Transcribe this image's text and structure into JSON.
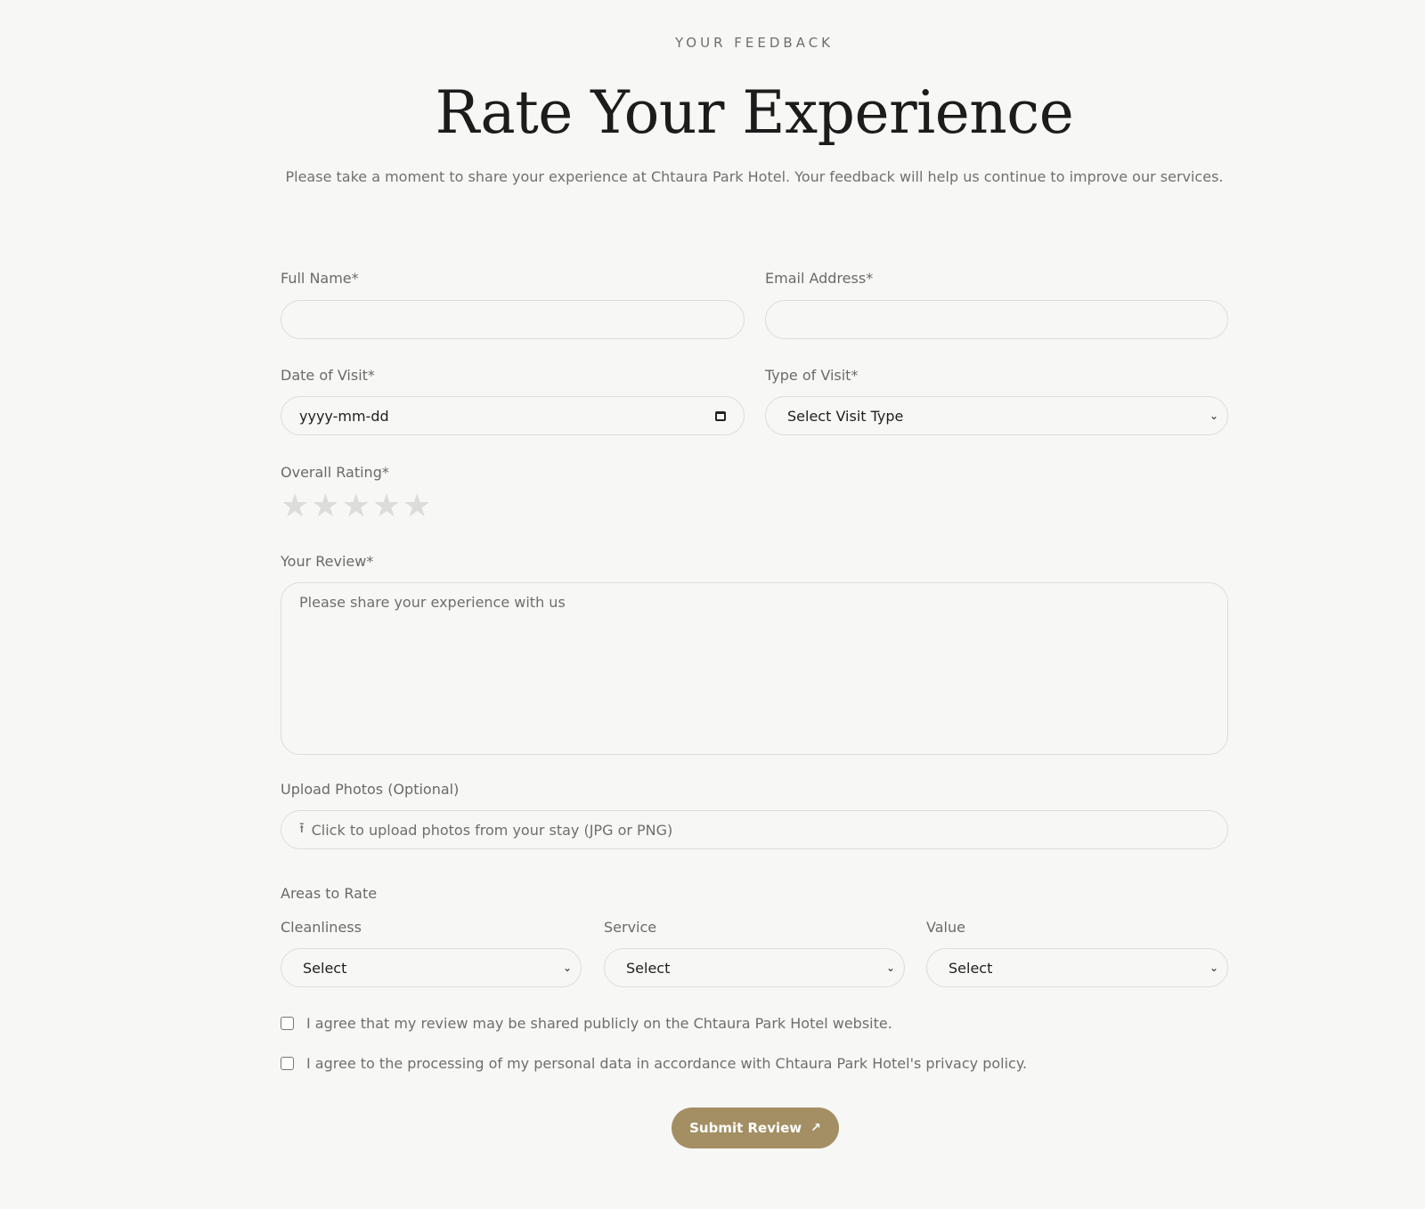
{
  "header": {
    "eyebrow": "YOUR FEEDBACK",
    "title": "Rate Your Experience",
    "subtitle": "Please take a moment to share your experience at Chtaura Park Hotel. Your feedback will help us continue to improve our services."
  },
  "form": {
    "full_name": {
      "label": "Full Name*",
      "value": ""
    },
    "email": {
      "label": "Email Address*",
      "value": ""
    },
    "date": {
      "label": "Date of Visit*",
      "placeholder": "yyyy-mm-dd"
    },
    "visit_type": {
      "label": "Type of Visit*",
      "selected": "Select Visit Type"
    },
    "rating": {
      "label": "Overall Rating*",
      "value": 0,
      "max": 5
    },
    "review": {
      "label": "Your Review*",
      "placeholder": "Please share your experience with us"
    },
    "upload": {
      "label": "Upload Photos (Optional)",
      "text": "Click to upload photos from your stay (JPG or PNG)"
    },
    "areas": {
      "label": "Areas to Rate",
      "cleanliness": {
        "label": "Cleanliness",
        "selected": "Select"
      },
      "service": {
        "label": "Service",
        "selected": "Select"
      },
      "value": {
        "label": "Value",
        "selected": "Select"
      }
    },
    "consent_public": "I agree that my review may be shared publicly on the Chtaura Park Hotel website.",
    "consent_privacy": "I agree to the processing of my personal data in accordance with Chtaura Park Hotel's privacy policy.",
    "submit_label": "Submit Review"
  },
  "icons": {
    "star": "star-icon",
    "calendar": "calendar-icon",
    "chevron": "chevron-down-icon",
    "upload": "upload-icon",
    "arrow": "arrow-up-right-icon"
  },
  "colors": {
    "accent": "#a38f63",
    "star_empty": "#dcdcda",
    "background": "#f7f7f5"
  }
}
